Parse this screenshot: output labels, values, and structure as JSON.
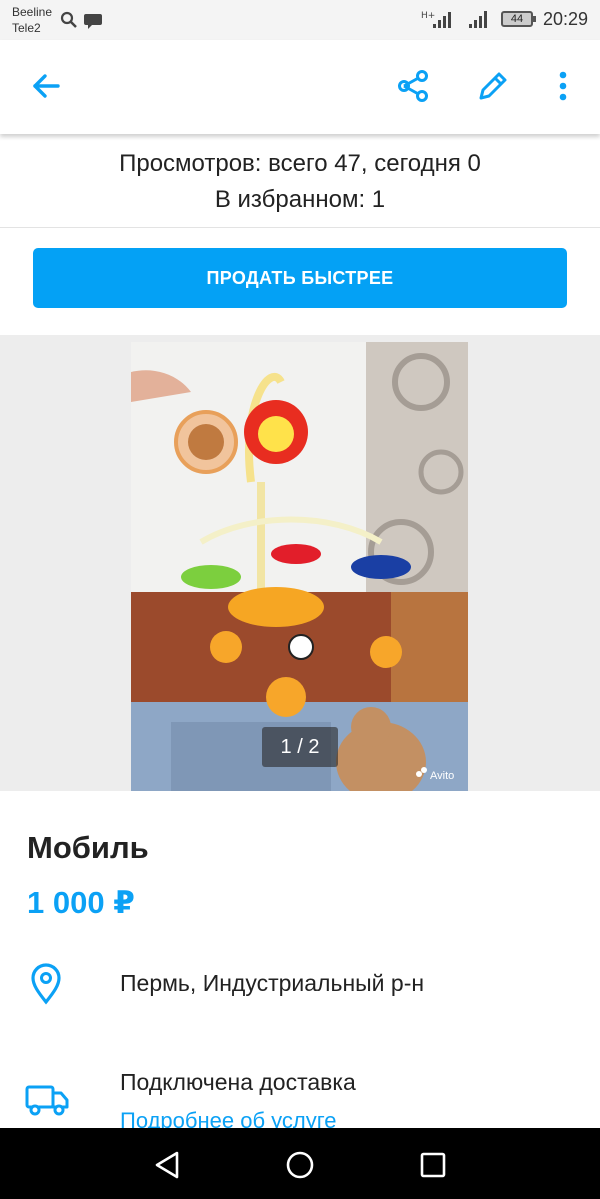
{
  "status_bar": {
    "carrier_1": "Beeline",
    "carrier_2": "Tele2",
    "network_1": "H+",
    "battery": "44",
    "time": "20:29"
  },
  "toolbar": {
    "icons": [
      "arrow-left-icon",
      "share-icon",
      "pencil-icon",
      "more-vertical-icon"
    ],
    "accent_color": "#0ba1f5"
  },
  "stats": {
    "views": "Просмотров: всего 47, сегодня 0",
    "favorites": "В избранном: 1"
  },
  "sell_button": {
    "label": "ПРОДАТЬ БЫСТРЕЕ",
    "color": "#04a1f5"
  },
  "gallery": {
    "counter": "1 / 2",
    "watermark": "Avito"
  },
  "listing": {
    "title": "Мобиль",
    "price": "1 000 ₽",
    "location": "Пермь, Индустриальный р-н",
    "delivery": "Подключена доставка",
    "delivery_link": "Подробнее об услуге"
  },
  "nav_bar": {
    "icons": [
      "back-triangle-icon",
      "home-circle-icon",
      "recents-square-icon"
    ]
  }
}
